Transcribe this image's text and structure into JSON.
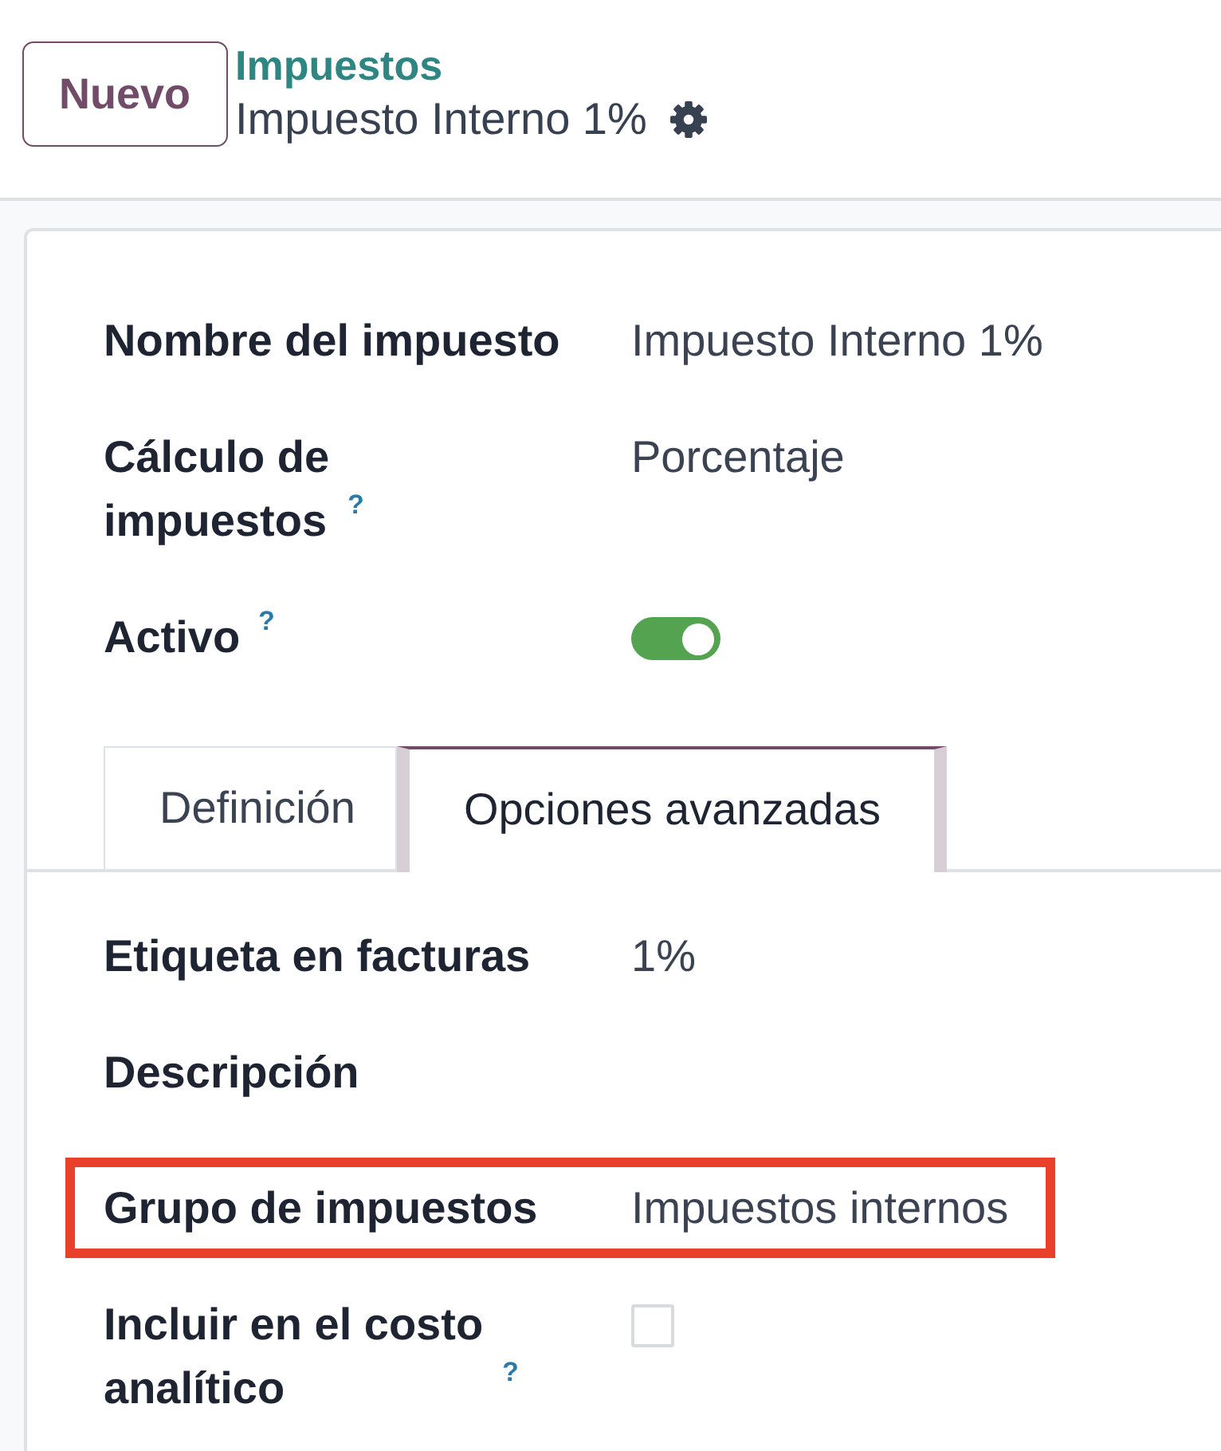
{
  "header": {
    "new_button": "Nuevo",
    "breadcrumb": "Impuestos",
    "record_title": "Impuesto Interno 1%"
  },
  "fields": [
    {
      "kind": "text",
      "label": "Nombre del impuesto",
      "value": "Impuesto Interno 1%",
      "highlighted": false
    },
    {
      "kind": "text",
      "label": "Cálculo de impuestos",
      "help": "?",
      "value": "Porcentaje",
      "highlighted": false
    },
    {
      "kind": "toggle",
      "label": "Activo",
      "help": "?",
      "on": true,
      "highlighted": false
    }
  ],
  "tabs": [
    {
      "label": "Definición",
      "selected": false
    },
    {
      "label": "Opciones avanzadas",
      "selected": true
    }
  ],
  "tab_fields": [
    {
      "kind": "text",
      "label": "Etiqueta en facturas",
      "value": "1%",
      "highlighted": false
    },
    {
      "kind": "text",
      "label": "Descripción",
      "highlighted": false
    },
    {
      "kind": "text",
      "label": "Grupo de impuestos",
      "value": "Impuestos internos",
      "highlighted": true
    },
    {
      "kind": "checkbox",
      "label": "Incluir en el costo analítico",
      "help": "?",
      "checked": false,
      "highlighted": false
    }
  ]
}
